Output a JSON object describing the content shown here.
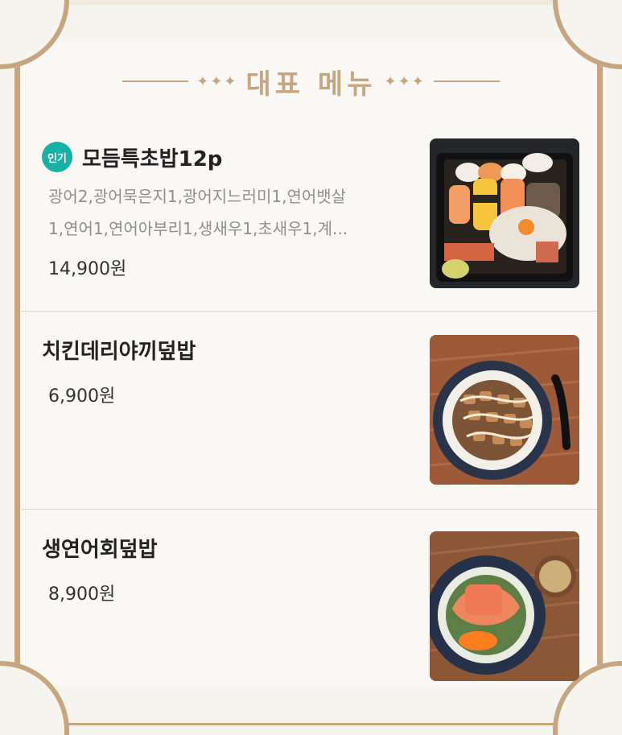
{
  "section_title": "대표 메뉴",
  "title_ornament_left": "✦✦✦",
  "title_ornament_right": "✦✦✦",
  "items": [
    {
      "badge": "인기",
      "name": "모듬특초밥12p",
      "description_line1": "광어2,광어묵은지1,광어지느러미1,연어뱃살",
      "description_line2": "1,연어1,연어아부리1,생새우1,초새우1,계...",
      "price": "14,900원",
      "image": "sushi-platter-photo"
    },
    {
      "name": "치킨데리야끼덮밥",
      "price": "6,900원",
      "image": "chicken-teriyaki-bowl-photo"
    },
    {
      "name": "생연어회덮밥",
      "price": "8,900원",
      "image": "salmon-sashimi-bowl-photo"
    }
  ],
  "colors": {
    "accent_gold": "#c7a57f",
    "badge_teal": "#18b1a5",
    "text_dark": "#222222",
    "text_muted": "#8f8f8f"
  }
}
